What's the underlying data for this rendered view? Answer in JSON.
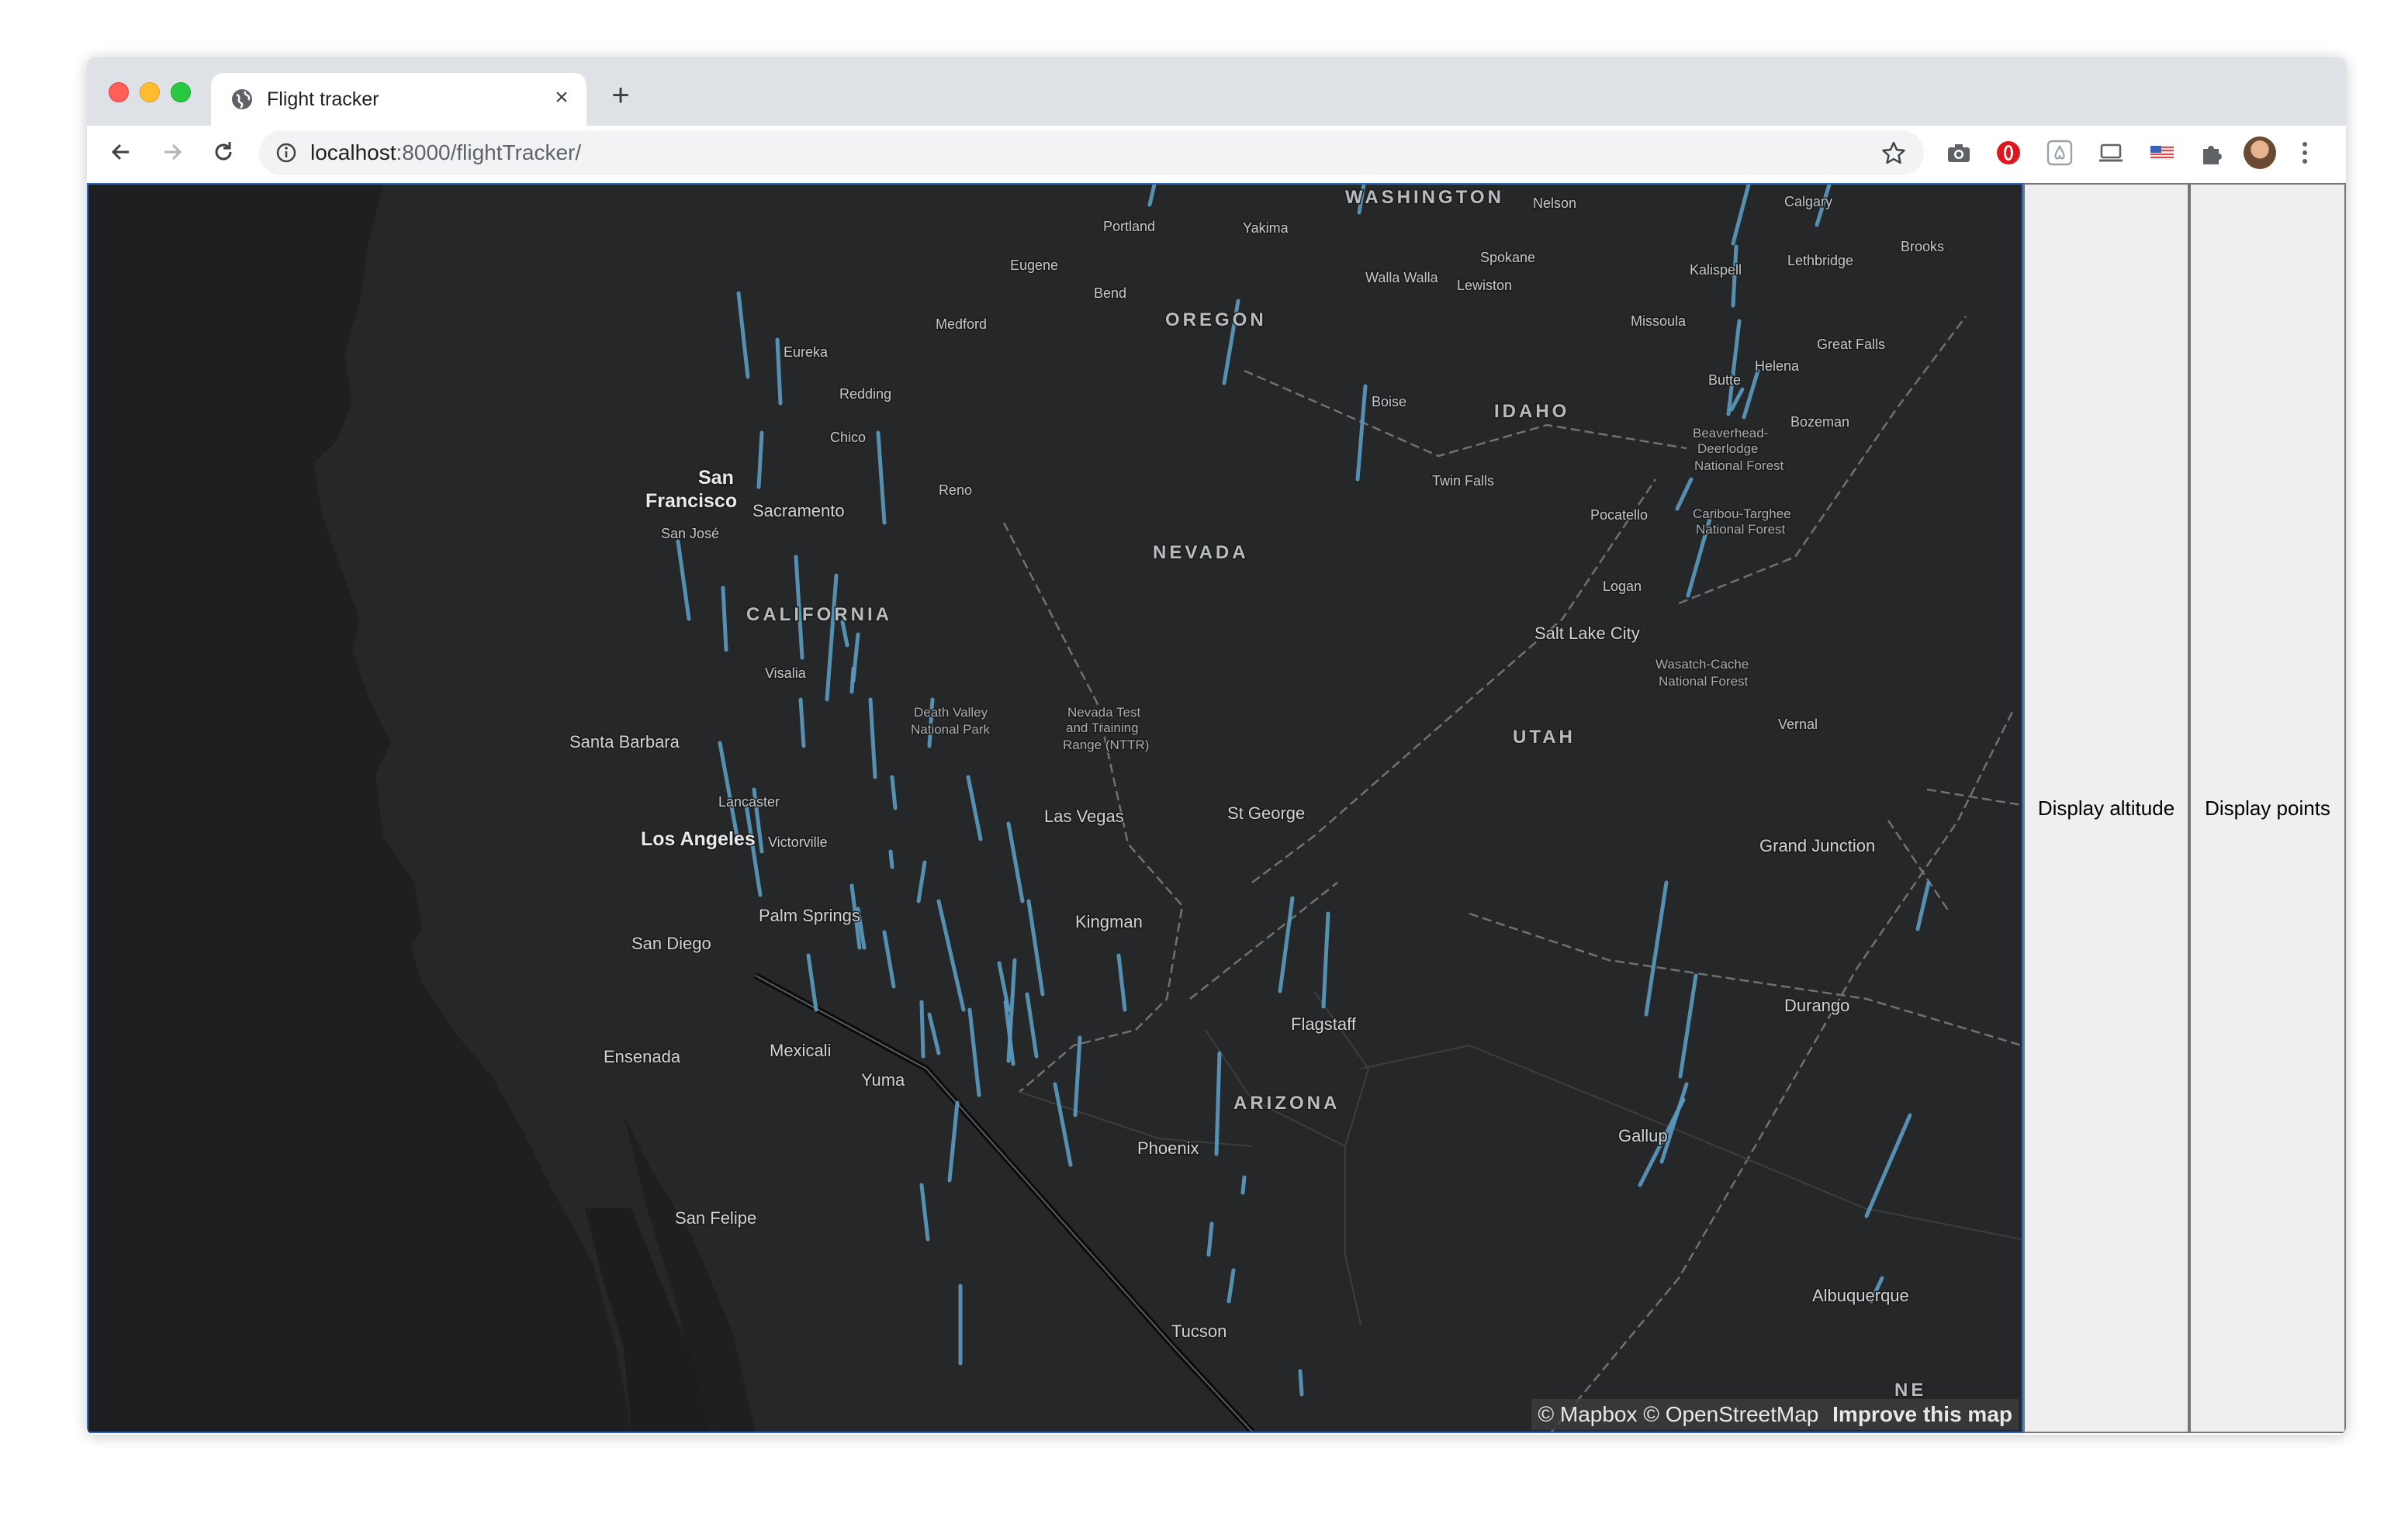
{
  "browser": {
    "tab_title": "Flight tracker",
    "url_host": "localhost",
    "url_rest": ":8000/flightTracker/",
    "new_tab_label": "+",
    "close_tab_label": "×"
  },
  "map": {
    "labels": [
      {
        "text": "WASHINGTON",
        "kind": "state"
      },
      {
        "text": "Nelson",
        "kind": "city-small"
      },
      {
        "text": "Calgary",
        "kind": "city-small"
      },
      {
        "text": "Portland",
        "kind": "city-small"
      },
      {
        "text": "Yakima",
        "kind": "city-small"
      },
      {
        "text": "Brooks",
        "kind": "city-small"
      },
      {
        "text": "Eugene",
        "kind": "city-small"
      },
      {
        "text": "Spokane",
        "kind": "city-small"
      },
      {
        "text": "Lethbridge",
        "kind": "city-small"
      },
      {
        "text": "Walla Walla",
        "kind": "city-small"
      },
      {
        "text": "Kalispell",
        "kind": "city-small"
      },
      {
        "text": "Bend",
        "kind": "city-small"
      },
      {
        "text": "Lewiston",
        "kind": "city-small"
      },
      {
        "text": "Medford",
        "kind": "city-small"
      },
      {
        "text": "OREGON",
        "kind": "state"
      },
      {
        "text": "Missoula",
        "kind": "city-small"
      },
      {
        "text": "Eureka",
        "kind": "city-small"
      },
      {
        "text": "Great Falls",
        "kind": "city-small"
      },
      {
        "text": "Helena",
        "kind": "city-small"
      },
      {
        "text": "Butte",
        "kind": "city-small"
      },
      {
        "text": "Redding",
        "kind": "city-small"
      },
      {
        "text": "Boise",
        "kind": "city-small"
      },
      {
        "text": "IDAHO",
        "kind": "state"
      },
      {
        "text": "Bozeman",
        "kind": "city-small"
      },
      {
        "text": "Chico",
        "kind": "city-small"
      },
      {
        "text": "Beaverhead-",
        "kind": "park"
      },
      {
        "text": "Deerlodge",
        "kind": "park"
      },
      {
        "text": "National Forest",
        "kind": "park"
      },
      {
        "text": "San",
        "kind": "city-large"
      },
      {
        "text": "Francisco",
        "kind": "city-large"
      },
      {
        "text": "Twin Falls",
        "kind": "city-small"
      },
      {
        "text": "Reno",
        "kind": "city-small"
      },
      {
        "text": "Sacramento",
        "kind": "city"
      },
      {
        "text": "Pocatello",
        "kind": "city-small"
      },
      {
        "text": "Caribou-Targhee",
        "kind": "park"
      },
      {
        "text": "National Forest",
        "kind": "park"
      },
      {
        "text": "San José",
        "kind": "city-small"
      },
      {
        "text": "NEVADA",
        "kind": "state"
      },
      {
        "text": "Logan",
        "kind": "city-small"
      },
      {
        "text": "CALIFORNIA",
        "kind": "state"
      },
      {
        "text": "Salt Lake City",
        "kind": "city"
      },
      {
        "text": "Wasatch-Cache",
        "kind": "park"
      },
      {
        "text": "National Forest",
        "kind": "park"
      },
      {
        "text": "Visalia",
        "kind": "city-small"
      },
      {
        "text": "Death Valley",
        "kind": "park"
      },
      {
        "text": "National Park",
        "kind": "park"
      },
      {
        "text": "Nevada Test",
        "kind": "park"
      },
      {
        "text": "and Training",
        "kind": "park"
      },
      {
        "text": "Range (NTTR)",
        "kind": "park"
      },
      {
        "text": "Vernal",
        "kind": "city-small"
      },
      {
        "text": "UTAH",
        "kind": "state"
      },
      {
        "text": "Santa Barbara",
        "kind": "city"
      },
      {
        "text": "Lancaster",
        "kind": "city-small"
      },
      {
        "text": "St George",
        "kind": "city"
      },
      {
        "text": "Las Vegas",
        "kind": "city"
      },
      {
        "text": "Los Angeles",
        "kind": "city-large"
      },
      {
        "text": "Victorville",
        "kind": "city-small"
      },
      {
        "text": "Grand Junction",
        "kind": "city"
      },
      {
        "text": "Palm Springs",
        "kind": "city"
      },
      {
        "text": "Kingman",
        "kind": "city"
      },
      {
        "text": "San Diego",
        "kind": "city"
      },
      {
        "text": "Durango",
        "kind": "city"
      },
      {
        "text": "Flagstaff",
        "kind": "city"
      },
      {
        "text": "Ensenada",
        "kind": "city"
      },
      {
        "text": "Mexicali",
        "kind": "city"
      },
      {
        "text": "Yuma",
        "kind": "city"
      },
      {
        "text": "ARIZONA",
        "kind": "state"
      },
      {
        "text": "Gallup",
        "kind": "city"
      },
      {
        "text": "Phoenix",
        "kind": "city"
      },
      {
        "text": "San Felipe",
        "kind": "city"
      },
      {
        "text": "Albuquerque",
        "kind": "city"
      },
      {
        "text": "Tucson",
        "kind": "city"
      },
      {
        "text": "NE",
        "kind": "state"
      }
    ],
    "flight_color": "#5b9bc0",
    "background_color": "#1e1f20",
    "land_color": "#262728"
  },
  "attribution": {
    "mapbox": "© Mapbox",
    "osm": "© OpenStreetMap",
    "improve": "Improve this map"
  },
  "buttons": {
    "display_altitude": "Display altitude",
    "display_points": "Display points"
  }
}
